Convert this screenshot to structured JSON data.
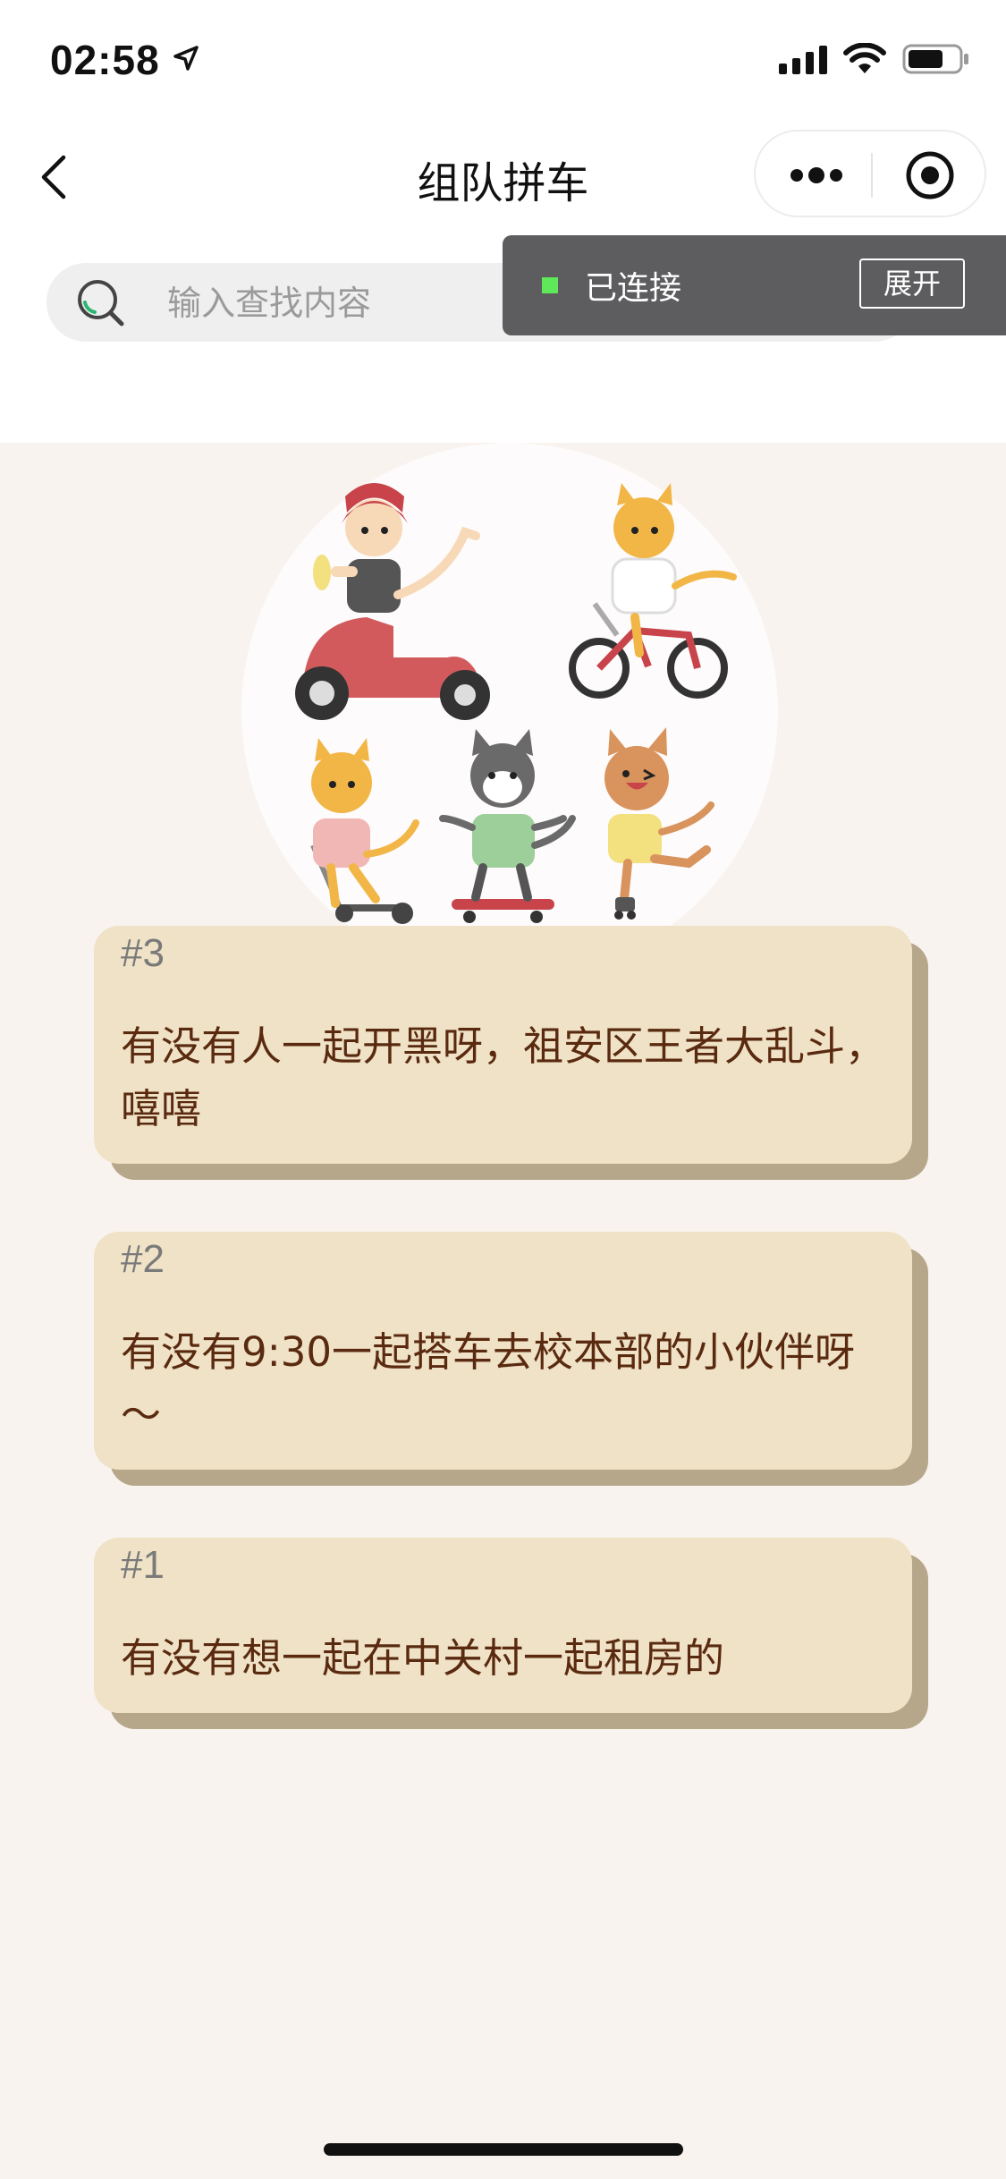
{
  "status_bar": {
    "time": "02:58"
  },
  "nav": {
    "title": "组队拼车"
  },
  "search": {
    "placeholder": "输入查找内容"
  },
  "connection": {
    "status": "已连接",
    "expand_label": "展开"
  },
  "posts": [
    {
      "number": "#3",
      "text": "有没有人一起开黑呀，祖安区王者大乱斗，嘻嘻"
    },
    {
      "number": "#2",
      "text": "有没有9:30一起搭车去校本部的小伙伴呀～"
    },
    {
      "number": "#1",
      "text": "有没有想一起在中关村一起租房的"
    }
  ],
  "colors": {
    "card_bg": "#efe2c6",
    "card_shadow": "#b6a78b",
    "card_text": "#5a2a10",
    "page_bg": "#f8f3ee",
    "connection_bar": "#5d5d5f",
    "connection_dot": "#5ee85a"
  },
  "icons": [
    "location-arrow-icon",
    "signal-icon",
    "wifi-icon",
    "battery-icon",
    "back-chevron-icon",
    "more-dots-icon",
    "target-icon",
    "search-icon"
  ]
}
